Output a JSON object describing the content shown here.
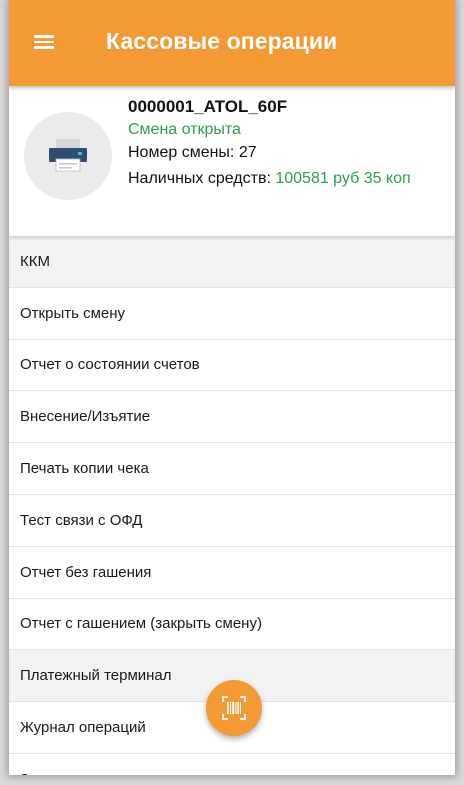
{
  "appbar": {
    "title": "Кассовые операции",
    "menu_icon": "hamburger-menu-icon"
  },
  "device": {
    "name": "0000001_ATOL_60F",
    "shift_status": "Смена открыта",
    "shift_number_label": "Номер смены: 27",
    "cash_label": "Наличных средств: ",
    "cash_amount": "100581 руб 35 коп",
    "icon": "printer-icon"
  },
  "list": {
    "kkm_header": "ККМ",
    "items": [
      "Открыть смену",
      "Отчет о состоянии счетов",
      "Внесение/Изъятие",
      "Печать копии чека",
      "Тест связи с ОФД",
      "Отчет без гашения",
      "Отчет с гашением (закрыть смену)"
    ],
    "terminal_header": "Платежный терминал",
    "terminal_items": [
      "Журнал операций",
      "Закрытие смены"
    ]
  },
  "fab": {
    "icon": "barcode-scanner-icon"
  },
  "colors": {
    "accent": "#f39a35",
    "status_green": "#2e9e4e"
  }
}
